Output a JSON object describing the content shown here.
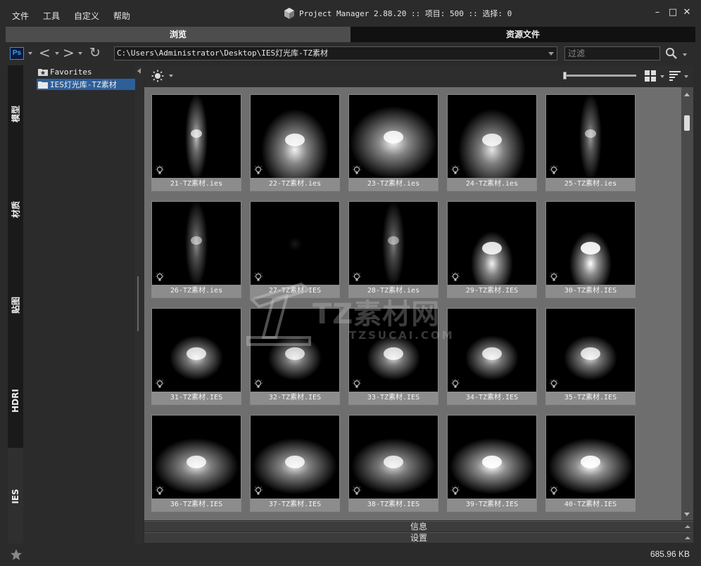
{
  "menu": [
    "文件",
    "工具",
    "自定义",
    "帮助"
  ],
  "app": {
    "title": "Project Manager 2.88.20  :: 项目: 500  :: 选择: 0",
    "icon": "cube-icon"
  },
  "window_controls": {
    "minimize": "–",
    "maximize": "□",
    "close": "✕"
  },
  "tabs": [
    {
      "label": "浏览",
      "active": true
    },
    {
      "label": "资源文件",
      "active": false
    }
  ],
  "toolbar": {
    "ps_label": "Ps",
    "back_glyph": "<",
    "forward_glyph": ">",
    "refresh_glyph": "↻",
    "path": "C:\\Users\\Administrator\\Desktop\\IES灯光库-TZ素材",
    "filter_placeholder": "过滤"
  },
  "side_tabs": [
    "模型",
    "材质",
    "贴图",
    "HDRI",
    "IES"
  ],
  "active_side_tab": "IES",
  "tree": [
    {
      "label": "Favorites",
      "icon": "star-folder-icon",
      "selected": false
    },
    {
      "label": "IES灯光库-TZ素材",
      "icon": "folder-icon",
      "selected": true
    }
  ],
  "zoom_level": 0,
  "files": [
    {
      "name": "21-TZ素材.ies",
      "light": "narrow-beam",
      "intensity": 0.75
    },
    {
      "name": "22-TZ素材.ies",
      "light": "cone",
      "intensity": 0.95
    },
    {
      "name": "23-TZ素材.ies",
      "light": "wide-flood",
      "intensity": 0.95
    },
    {
      "name": "24-TZ素材.ies",
      "light": "cone",
      "intensity": 0.9
    },
    {
      "name": "25-TZ素材.ies",
      "light": "narrow-beam",
      "intensity": 0.6
    },
    {
      "name": "26-TZ素材.ies",
      "light": "narrow-beam",
      "intensity": 0.55
    },
    {
      "name": "27-TZ素材.IES",
      "light": "dark",
      "intensity": 0.1
    },
    {
      "name": "28-TZ素材.ies",
      "light": "narrow-beam",
      "intensity": 0.5
    },
    {
      "name": "29-TZ素材.IES",
      "light": "spot",
      "intensity": 0.95
    },
    {
      "name": "30-TZ素材.IES",
      "light": "spot",
      "intensity": 1.0
    },
    {
      "name": "31-TZ素材.IES",
      "light": "soft-spot",
      "intensity": 0.85
    },
    {
      "name": "32-TZ素材.IES",
      "light": "soft-spot",
      "intensity": 0.8
    },
    {
      "name": "33-TZ素材.IES",
      "light": "soft-spot",
      "intensity": 0.85
    },
    {
      "name": "34-TZ素材.IES",
      "light": "soft-spot",
      "intensity": 0.85
    },
    {
      "name": "35-TZ素材.IES",
      "light": "soft-spot",
      "intensity": 0.85
    },
    {
      "name": "36-TZ素材.IES",
      "light": "wide-soft",
      "intensity": 0.9
    },
    {
      "name": "37-TZ素材.IES",
      "light": "wide-soft",
      "intensity": 0.9
    },
    {
      "name": "38-TZ素材.IES",
      "light": "wide-soft",
      "intensity": 0.85
    },
    {
      "name": "39-TZ素材.IES",
      "light": "wide-soft",
      "intensity": 1.0
    },
    {
      "name": "40-TZ素材.IES",
      "light": "wide-soft",
      "intensity": 1.0
    }
  ],
  "watermark": {
    "main": "TZ素材网",
    "sub": "TZSUCAI.COM"
  },
  "panels": [
    "信息",
    "设置"
  ],
  "status": {
    "size": "685.96 KB"
  },
  "colors": {
    "accent_selected": "#2d5f9a",
    "ps_blue": "#3fa0ff"
  }
}
